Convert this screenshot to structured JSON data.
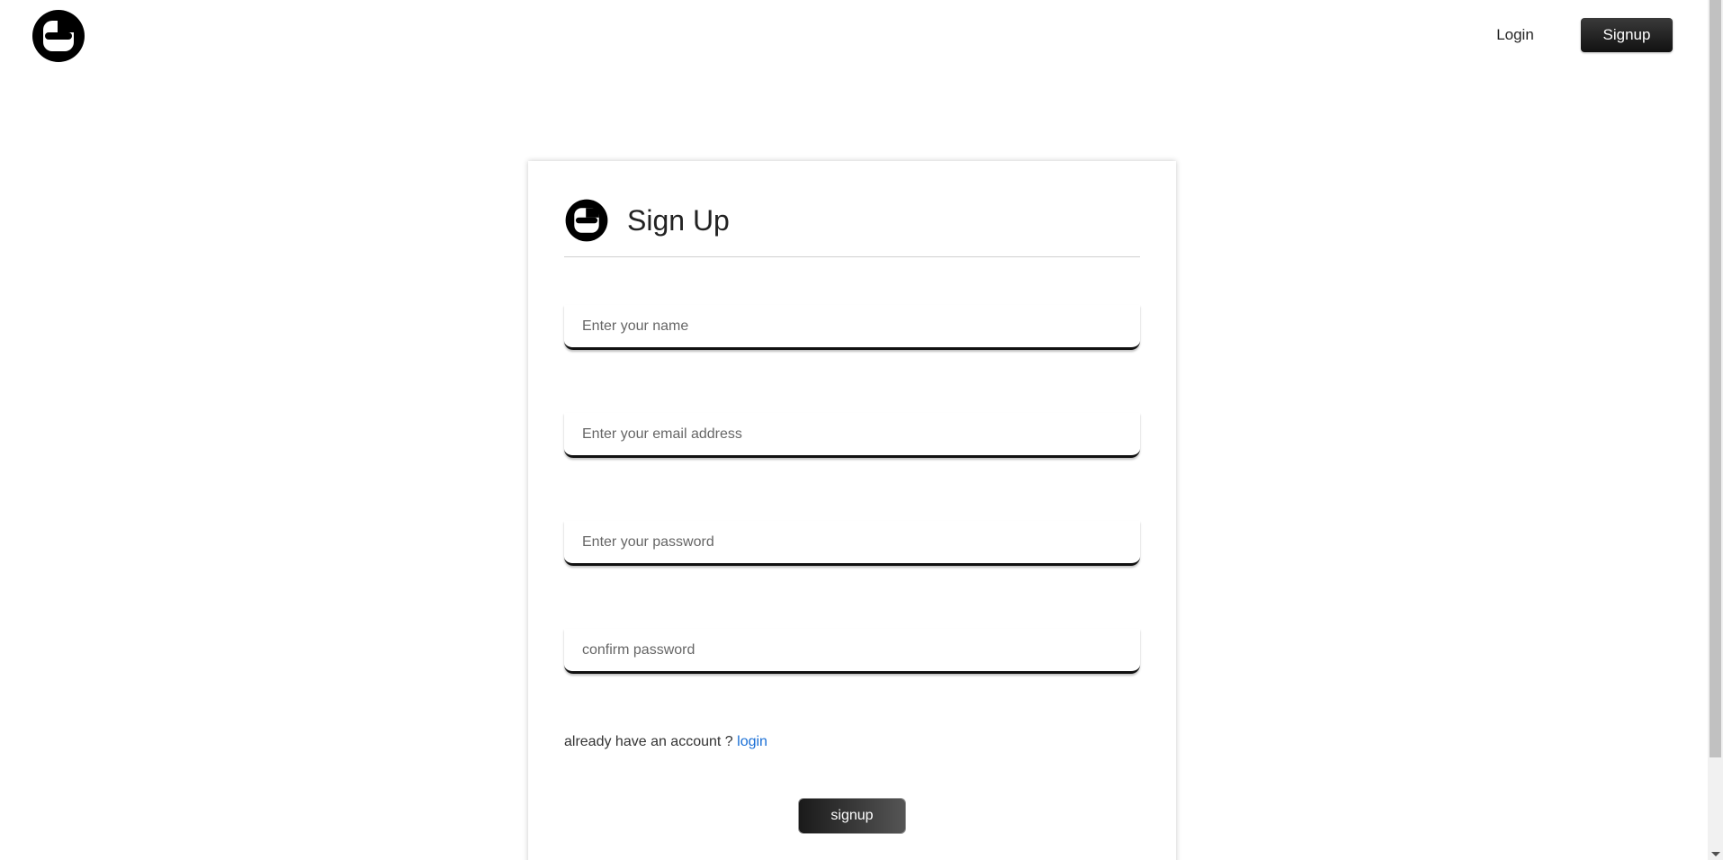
{
  "header": {
    "logo_icon": "blogger-logo-icon",
    "nav": {
      "login_label": "Login",
      "signup_label": "Signup"
    }
  },
  "card": {
    "logo_icon": "blogger-logo-icon",
    "title": "Sign Up",
    "fields": {
      "name_placeholder": "Enter your name",
      "email_placeholder": "Enter your email address",
      "password_placeholder": "Enter your password",
      "confirm_placeholder": "confirm password"
    },
    "account_prompt": "already have an account ?",
    "login_link": "login",
    "submit_label": "signup"
  },
  "colors": {
    "accent_dark": "#111111",
    "link": "#1a6fd6"
  }
}
